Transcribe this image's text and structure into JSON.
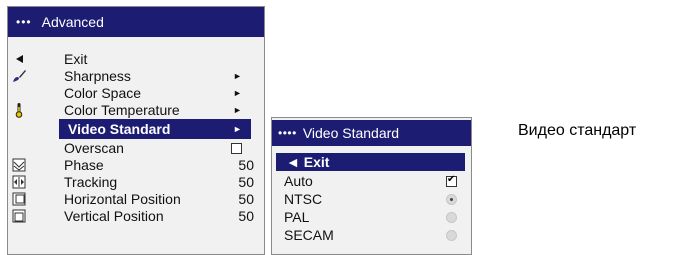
{
  "main_menu": {
    "title_dots": "•••",
    "title": "Advanced",
    "items": [
      {
        "label": "Exit",
        "icon": "left-triangle-icon",
        "arrow": "",
        "value": ""
      },
      {
        "label": "Sharpness",
        "icon": "brush-icon",
        "arrow": "►",
        "value": ""
      },
      {
        "label": "Color Space",
        "icon": "",
        "arrow": "►",
        "value": ""
      },
      {
        "label": "Color Temperature",
        "icon": "thermometer-icon",
        "arrow": "►",
        "value": ""
      },
      {
        "label": "Video Standard",
        "icon": "",
        "arrow": "►",
        "value": ""
      },
      {
        "label": "Overscan",
        "icon": "",
        "arrow": "",
        "value": ""
      },
      {
        "label": "Phase",
        "icon": "phase-icon",
        "arrow": "",
        "value": "50"
      },
      {
        "label": "Tracking",
        "icon": "tracking-icon",
        "arrow": "",
        "value": "50"
      },
      {
        "label": "Horizontal Position",
        "icon": "horizontal-position-icon",
        "arrow": "",
        "value": "50"
      },
      {
        "label": "Vertical Position",
        "icon": "vertical-position-icon",
        "arrow": "",
        "value": "50"
      }
    ],
    "selected": "Video Standard",
    "overscan_checked": false
  },
  "sub_menu": {
    "title_dots": "••••",
    "title": "Video Standard",
    "items": [
      {
        "label": "◄ Exit",
        "control": "none"
      },
      {
        "label": "Auto",
        "control": "checkbox",
        "checked": true
      },
      {
        "label": "NTSC",
        "control": "radio",
        "checked": true
      },
      {
        "label": "PAL",
        "control": "radio",
        "checked": false
      },
      {
        "label": "SECAM",
        "control": "radio",
        "checked": false
      }
    ]
  },
  "side_label": "Видео стандарт",
  "colors": {
    "title_bar": "#1c1c73",
    "menu_bg": "#f1f1f1",
    "text": "#111111"
  }
}
